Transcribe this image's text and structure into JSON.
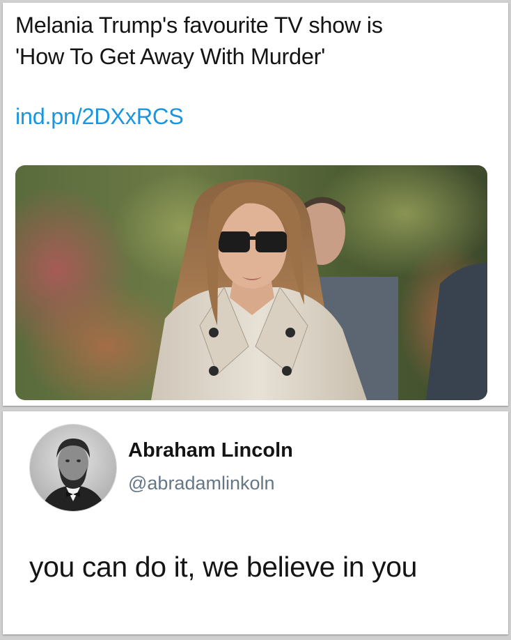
{
  "top_tweet": {
    "text_lines": [
      "Melania Trump's favourite TV show is",
      "'How To Get Away With Murder'"
    ],
    "link": "ind.pn/2DXxRCS",
    "link_color": "#1b95e0",
    "photo_icon": "photo-of-woman-in-sunglasses-and-trench-coat"
  },
  "reply_tweet": {
    "display_name": "Abraham Lincoln",
    "handle": "@abradamlinkoln",
    "avatar_icon": "portrait-avatar",
    "text": "you can do it, we believe in you",
    "handle_color": "#657786"
  }
}
